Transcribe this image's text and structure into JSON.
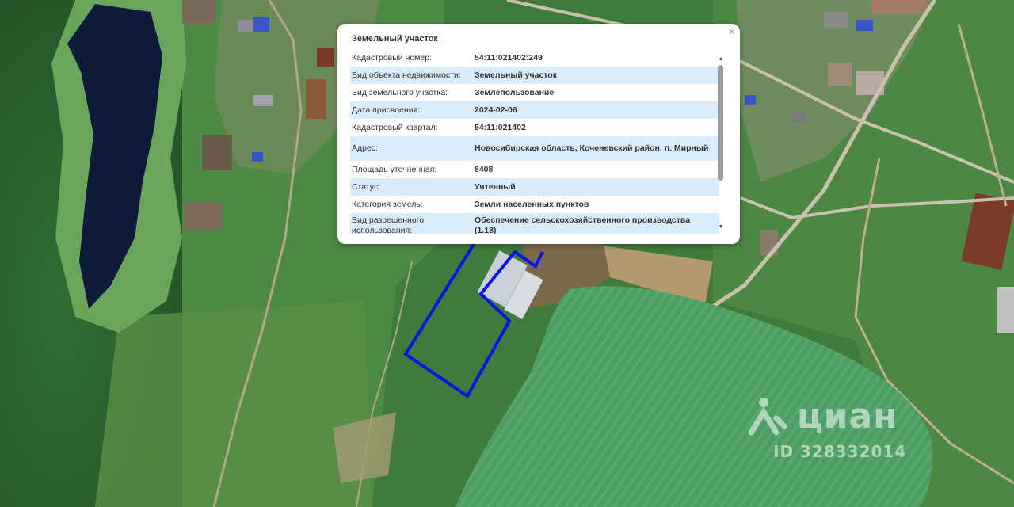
{
  "popup": {
    "title": "Земельный участок",
    "close_icon": "close-icon",
    "rows": [
      {
        "label": "Кадастровый номер:",
        "value": "54:11:021402:249"
      },
      {
        "label": "Вид объекта недвижимости:",
        "value": "Земельный участок"
      },
      {
        "label": "Вид земельного участка:",
        "value": "Землепользование"
      },
      {
        "label": "Дата присвоения:",
        "value": "2024-02-06"
      },
      {
        "label": "Кадастровый квартал:",
        "value": "54:11:021402"
      },
      {
        "label": "Адрес:",
        "value": "Новосибирская область, Коченевский район, п. Мирный"
      },
      {
        "label": "Площадь уточненная:",
        "value": "8408"
      },
      {
        "label": "Статус:",
        "value": "Учтенный"
      },
      {
        "label": "Категория земель:",
        "value": "Земли населенных пунктов"
      },
      {
        "label": "Вид разрешенного использования:",
        "value": "Обеспечение сельскохозяйственного производства (1.18)"
      }
    ]
  },
  "watermark": {
    "brand": "циан",
    "id_text": "ID 328332014"
  },
  "colors": {
    "parcel_outline": "#0a14e6",
    "row_highlight": "#d9ecfb"
  }
}
